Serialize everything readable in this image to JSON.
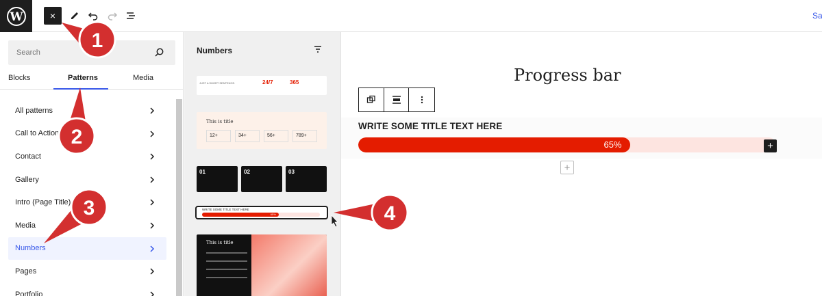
{
  "topbar": {
    "logo": "wordpress-logo",
    "close_label": "×",
    "save_label": "Save"
  },
  "inserter": {
    "search_placeholder": "Search",
    "tabs": [
      "Blocks",
      "Patterns",
      "Media"
    ],
    "active_tab": "Patterns",
    "categories": [
      {
        "label": "All patterns",
        "active": false
      },
      {
        "label": "Call to Action",
        "active": false
      },
      {
        "label": "Contact",
        "active": false
      },
      {
        "label": "Gallery",
        "active": false
      },
      {
        "label": "Intro (Page Title)",
        "active": false
      },
      {
        "label": "Media",
        "active": false
      },
      {
        "label": "Numbers",
        "active": true
      },
      {
        "label": "Pages",
        "active": false
      },
      {
        "label": "Portfolio",
        "active": false
      }
    ]
  },
  "patterns_panel": {
    "title": "Numbers",
    "preview1": {
      "text": "JUST A SHORT SENTENCE.",
      "stats": [
        "24/7",
        "365"
      ]
    },
    "preview2": {
      "title": "This is title",
      "stats": [
        "12+",
        "34+",
        "56+",
        "789+"
      ]
    },
    "preview3": {
      "nums": [
        "01",
        "02",
        "03"
      ]
    },
    "preview4": {
      "title": "WRITE SOME TITLE TEXT HERE",
      "percent": "65%"
    },
    "preview5": {
      "title": "This is title"
    }
  },
  "canvas": {
    "heading": "Progress bar",
    "progress_title": "WRITE SOME TITLE TEXT HERE",
    "progress_label": "65%",
    "progress_value": 65,
    "accent_color": "#e41c00",
    "track_color": "#fde4e0"
  },
  "annotations": [
    "1",
    "2",
    "3",
    "4"
  ]
}
